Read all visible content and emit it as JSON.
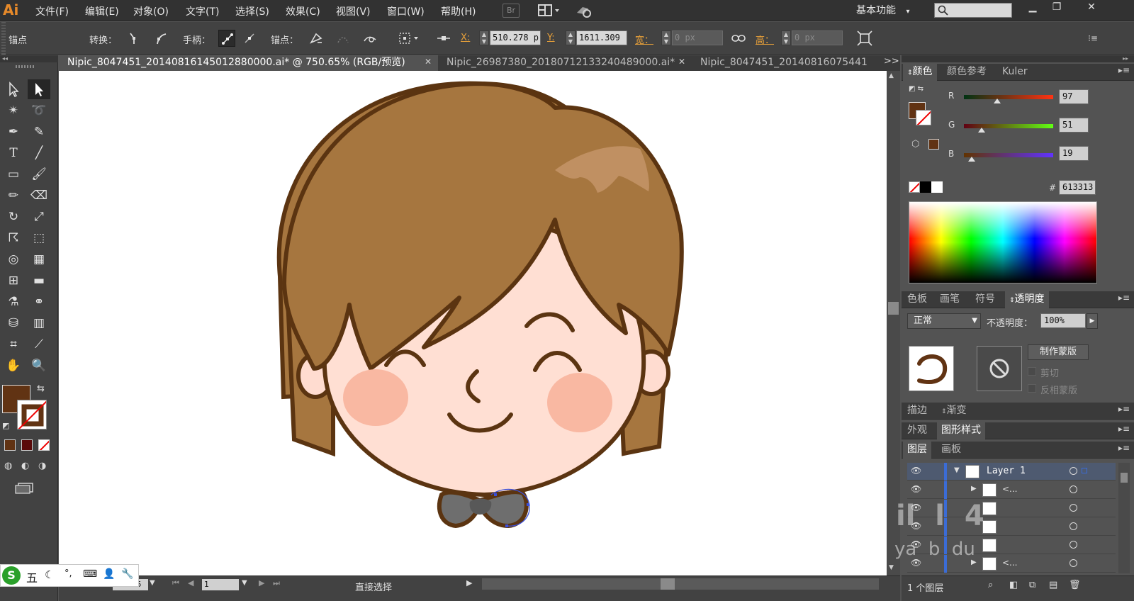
{
  "app": {
    "logo": "Ai",
    "bridge_label": "Br"
  },
  "menu": {
    "items": [
      "文件(F)",
      "编辑(E)",
      "对象(O)",
      "文字(T)",
      "选择(S)",
      "效果(C)",
      "视图(V)",
      "窗口(W)",
      "帮助(H)"
    ],
    "workspace": "基本功能"
  },
  "control_bar": {
    "mode_label": "锚点",
    "convert_label": "转换：",
    "handles_label": "手柄：",
    "anchors_label": "锚点：",
    "x_label": "X:",
    "x_value": "510.278 p",
    "y_label": "Y:",
    "y_value": "1611.309",
    "w_label": "宽：",
    "w_value": "0 px",
    "h_label": "高：",
    "h_value": "0 px"
  },
  "tabs": [
    {
      "label": "Nipic_8047451_20140816145012880000.ai* @ 750.65% (RGB/预览)",
      "active": true
    },
    {
      "label": "Nipic_26987380_20180712133240489000.ai*",
      "active": false
    },
    {
      "label": "Nipic_8047451_20140816075441",
      "active": false
    }
  ],
  "tab_overflow": ">>",
  "color_panel": {
    "tabs": [
      "颜色",
      "颜色参考",
      "Kuler"
    ],
    "r_label": "R",
    "r_value": "97",
    "g_label": "G",
    "g_value": "51",
    "b_label": "B",
    "b_value": "19",
    "hex_label": "#",
    "hex_value": "613313",
    "swatch_color": "#613313"
  },
  "swatch_panel": {
    "tabs": [
      "色板",
      "画笔",
      "符号",
      "透明度"
    ]
  },
  "transparency_panel": {
    "blend_mode": "正常",
    "opacity_label": "不透明度：",
    "opacity_value": "100%",
    "make_mask_label": "制作蒙版",
    "clip_label": "剪切",
    "invert_mask_label": "反相蒙版"
  },
  "stroke_panel": {
    "tabs": [
      "描边",
      "渐变"
    ]
  },
  "appearance_panel": {
    "tabs": [
      "外观",
      "图形样式"
    ]
  },
  "layers_panel": {
    "tabs": [
      "图层",
      "画板"
    ],
    "layer_name": "Layer 1",
    "sublayer_label": "<...",
    "count_label": "1 个图层"
  },
  "status_bar": {
    "zoom_value": "750.65",
    "artboard_value": "1",
    "tool_label": "直接选择"
  },
  "ime": {
    "mode_label": "五"
  },
  "watermark": {
    "line1": "il  l  4",
    "line2": "ya  b  du"
  }
}
